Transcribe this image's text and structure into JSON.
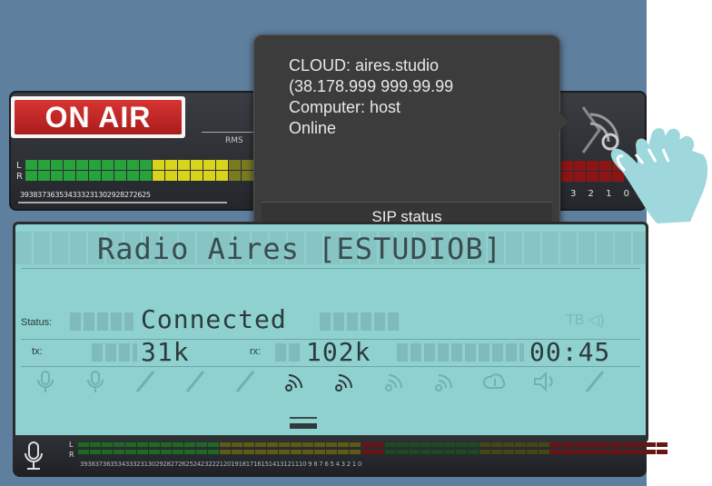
{
  "onair": {
    "label": "ON AIR"
  },
  "top_meter": {
    "rms_label": "RMS",
    "l_label": "L",
    "r_label": "R",
    "scale_text": "393837363534333231302928272625",
    "right_scale_text": "4 3 2 1 0"
  },
  "tooltip": {
    "lines": [
      "CLOUD: aires.studio",
      "(38.178.999 999.99.99",
      "Computer: host",
      "Online"
    ],
    "button": "SIP status"
  },
  "lcd": {
    "title": "Radio Aires [ESTUDIOB]",
    "status_label": "Status:",
    "status_value": "Connected",
    "tb_label": "TB",
    "tx_label": "tx:",
    "tx_value": "31k",
    "rx_label": "rx:",
    "rx_value": "102k",
    "timer": "00:45"
  },
  "bottom_meter": {
    "l_label": "L",
    "r_label": "R",
    "scale_text": "393837363534333231302928272625242322212019181716151413121110 9 8 7 6 5 4 3 2 1 0"
  },
  "colors": {
    "panel_bg": "#5e7f9e",
    "lcd_bg": "#8ed1cf",
    "onair_red": "#c42a28",
    "tooltip_bg": "#3c3c3c"
  },
  "icons": [
    "mic-icon",
    "mic-icon",
    "pen-icon",
    "pen-icon",
    "pen-icon",
    "wifi-icon",
    "wifi-icon",
    "wifi-icon",
    "wifi-icon",
    "cloud-download-icon",
    "speaker-icon",
    "pen-icon"
  ]
}
